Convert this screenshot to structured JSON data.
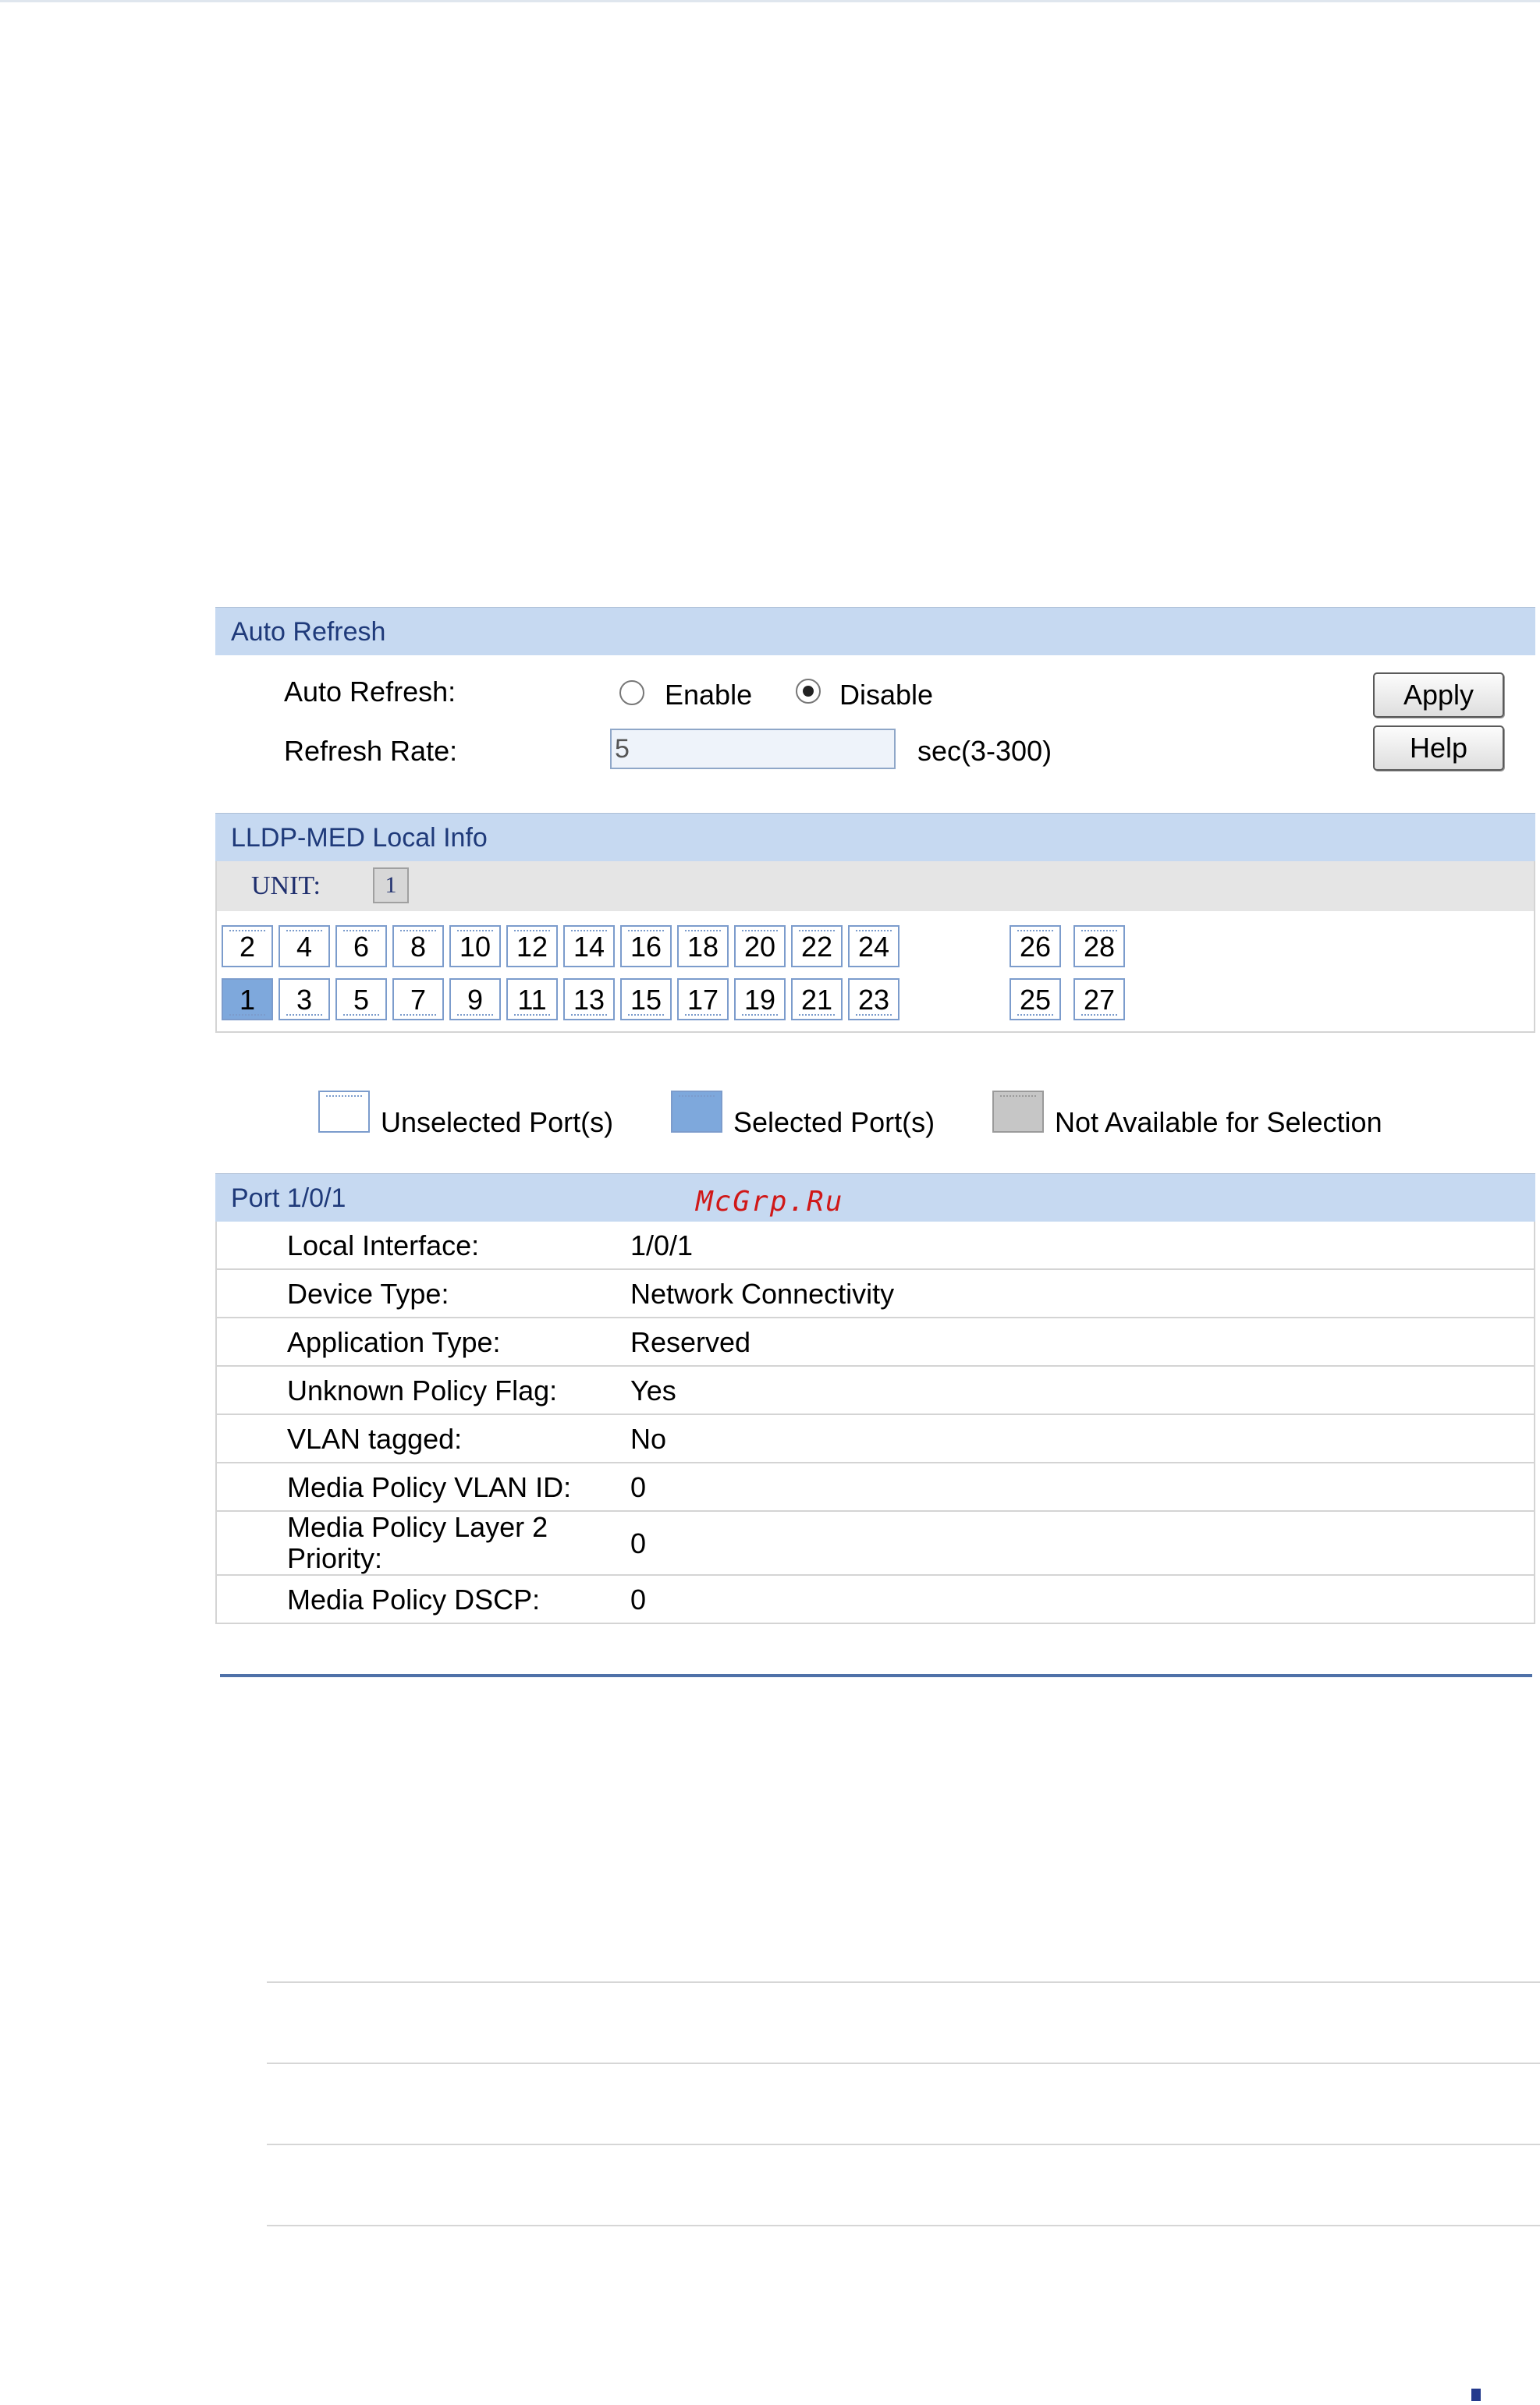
{
  "auto_refresh": {
    "header": "Auto Refresh",
    "auto_refresh_label": "Auto Refresh:",
    "enable_label": "Enable",
    "disable_label": "Disable",
    "selected": "Disable",
    "refresh_rate_label": "Refresh Rate:",
    "refresh_rate_value": "5",
    "refresh_rate_unit": "sec(3-300)",
    "apply_label": "Apply",
    "help_label": "Help"
  },
  "lldp_med": {
    "header": "LLDP-MED Local Info",
    "unit_label": "UNIT:",
    "unit_value": "1",
    "ports_top": [
      "2",
      "4",
      "6",
      "8",
      "10",
      "12",
      "14",
      "16",
      "18",
      "20",
      "22",
      "24",
      "26",
      "28"
    ],
    "ports_bottom": [
      "1",
      "3",
      "5",
      "7",
      "9",
      "11",
      "13",
      "15",
      "17",
      "19",
      "21",
      "23",
      "25",
      "27"
    ],
    "selected_port": "1"
  },
  "legend": {
    "unselected": "Unselected Port(s)",
    "selected": "Selected Port(s)",
    "not_available": "Not Available for Selection"
  },
  "port_info": {
    "header": "Port 1/0/1",
    "rows": [
      {
        "label": "Local Interface:",
        "value": "1/0/1"
      },
      {
        "label": "Device Type:",
        "value": "Network Connectivity"
      },
      {
        "label": "Application Type:",
        "value": "Reserved"
      },
      {
        "label": "Unknown Policy Flag:",
        "value": "Yes"
      },
      {
        "label": "VLAN tagged:",
        "value": "No"
      },
      {
        "label": "Media Policy VLAN ID:",
        "value": "0"
      },
      {
        "label": "Media Policy Layer 2 Priority:",
        "value": "0"
      },
      {
        "label": "Media Policy DSCP:",
        "value": "0"
      }
    ]
  },
  "watermark": "McGrp.Ru",
  "colors": {
    "header_bg": "#c6d9f1",
    "header_text": "#1f3a7a",
    "port_border": "#7c9ccc",
    "selected_port": "#7ea8dc",
    "not_available": "#c6c6c6",
    "watermark": "#d01818"
  }
}
